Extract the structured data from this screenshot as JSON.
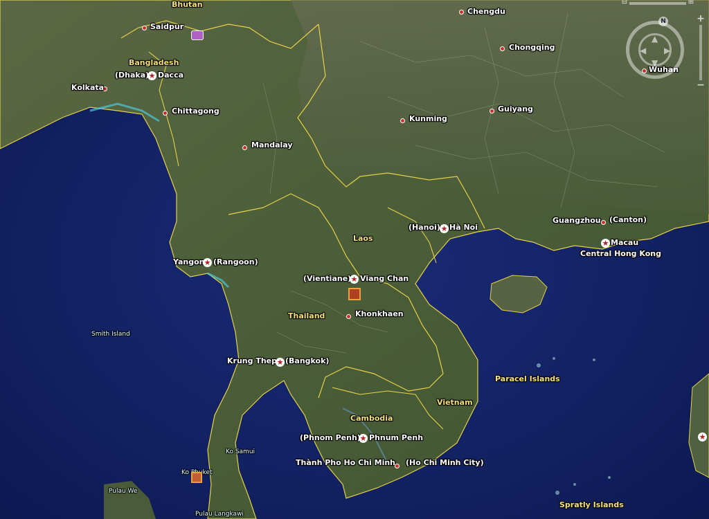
{
  "map": {
    "countries": [
      "Bhutan",
      "Bangladesh",
      "Laos",
      "Thailand",
      "Cambodia",
      "Vietnam"
    ],
    "seas": [
      "Paracel Islands",
      "Spratly Islands"
    ],
    "islands": [
      "Smith Island",
      "Ko Samui",
      "Ko Phuket",
      "Pulau We",
      "Pulau Langkawi"
    ],
    "cities": {
      "chengdu": "Chengdu",
      "chongqing": "Chongqing",
      "wuhan": "Wuhan",
      "saidpur": "Saidpur",
      "dhaka": "(Dhaka)",
      "dacca": "Dacca",
      "kolkata": "Kolkata",
      "chittagong": "Chittagong",
      "kunming": "Kunming",
      "guiyang": "Guiyang",
      "mandalay": "Mandalay",
      "guangzhou": "Guangzhou",
      "canton": "(Canton)",
      "hanoi_alt": "(Hanoi)",
      "hanoi": "Hà Noi",
      "macau": "Macau",
      "hongkong": "Central Hong Kong",
      "yangon": "Yangon",
      "rangoon": "(Rangoon)",
      "vientiane_alt": "(Vientiane)",
      "vientiane": "Viang Chan",
      "khonkhaen": "Khonkhaen",
      "bangkok": "Krung Thep",
      "bangkok_alt": "(Bangkok)",
      "phnompenh_alt": "(Phnom Penh)",
      "phnompenh": "Phnum Penh",
      "hcm": "Thành Pho Ho Chi Minh",
      "hcm_alt": "(Ho Chi Minh City)"
    }
  },
  "navigation": {
    "north": "N",
    "zoom_in": "+",
    "zoom_out": "−"
  }
}
